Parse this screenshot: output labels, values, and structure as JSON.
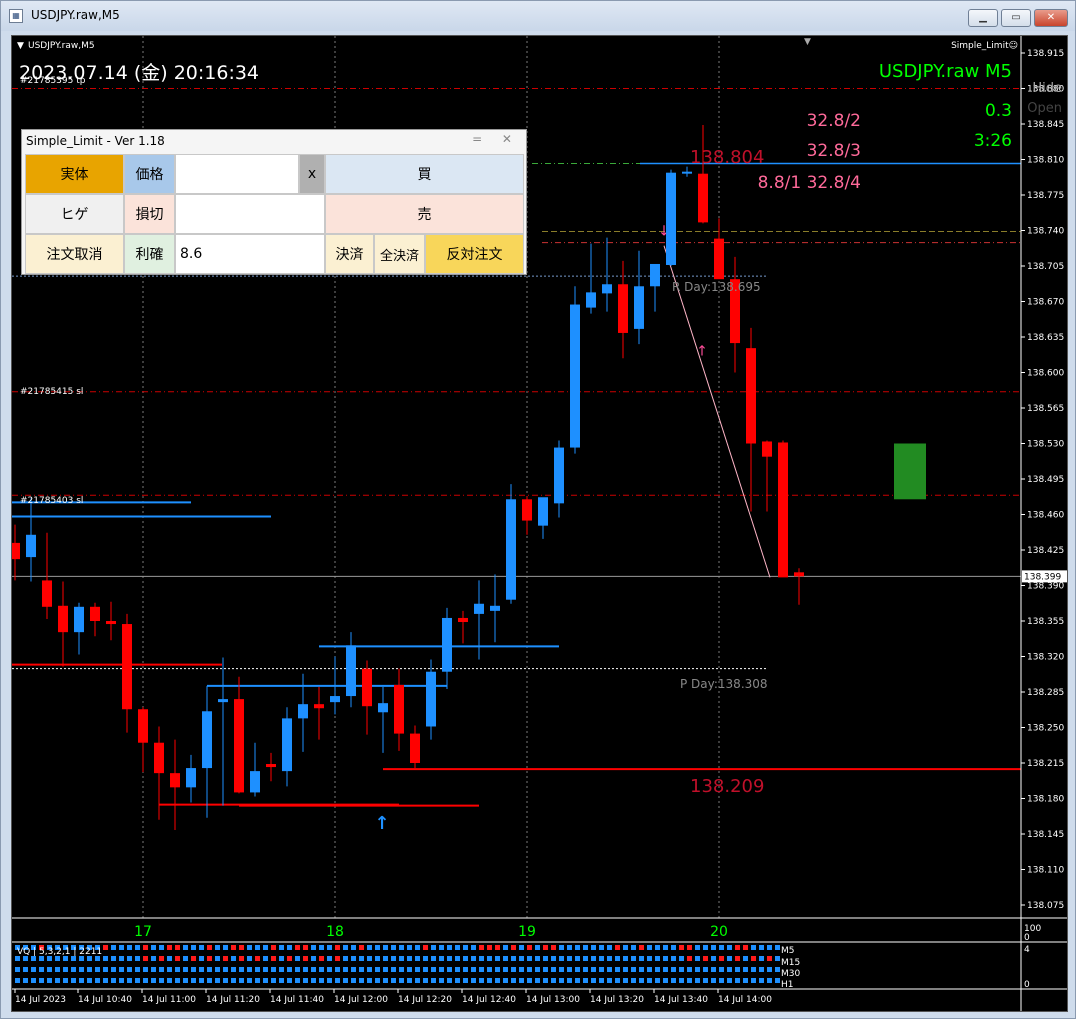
{
  "window": {
    "title": "USDJPY.raw,M5",
    "min_glyph": "▁",
    "max_glyph": "▭",
    "close_glyph": "✕"
  },
  "chart": {
    "corner_label": "USDJPY.raw,M5",
    "indicator_label": "Simple_Limit☺",
    "datetime": "2023.07.14 (金) 20:16:34",
    "symbol_tf": "USDJPY.raw  M5",
    "hide_label": "Hide",
    "open_label": "Open",
    "spread": "0.3",
    "countdown": "3:26",
    "stats": [
      "32.8/2",
      "32.8/3",
      "8.8/1  32.8/4"
    ],
    "high_price_label": "138.804",
    "low_price_label": "138.209",
    "r_day_label": "R Day:138.695",
    "p_day_label": "P Day:138.308",
    "order_labels": [
      "#21785395 tp",
      "#21785415 sl",
      "#21785403 sl"
    ],
    "price_ticks": [
      "138.915",
      "138.880",
      "138.845",
      "138.810",
      "138.775",
      "138.740",
      "138.705",
      "138.670",
      "138.635",
      "138.600",
      "138.565",
      "138.530",
      "138.495",
      "138.460",
      "138.425",
      "138.390",
      "138.355",
      "138.320",
      "138.285",
      "138.250",
      "138.215",
      "138.180",
      "138.145",
      "138.110",
      "138.075"
    ],
    "current_price": "138.399",
    "day_labels": [
      "17",
      "18",
      "19",
      "20"
    ],
    "sub_scale_top": "100",
    "sub_scale_bottom": "0",
    "sub2_scale_top": "4",
    "sub2_scale_bottom": "0",
    "vq_label": "VQ | 5,3,2,1 | 2211",
    "tf_labels": [
      "M5",
      "M15",
      "M30",
      "H1"
    ],
    "time_labels": [
      "14 Jul 2023",
      "14 Jul 10:40",
      "14 Jul 11:00",
      "14 Jul 11:20",
      "14 Jul 11:40",
      "14 Jul 12:00",
      "14 Jul 12:20",
      "14 Jul 12:40",
      "14 Jul 13:00",
      "14 Jul 13:20",
      "14 Jul 13:40",
      "14 Jul 14:00"
    ],
    "colors": {
      "bull": "#1e90ff",
      "bear": "#ff0000",
      "green_text": "#00ff00",
      "pink_text": "#ff6a9a",
      "grid": "#8a8a8a"
    }
  },
  "panel": {
    "title": "Simple_Limit - Ver 1.18",
    "controls": "= ✕",
    "btn_body": "実体",
    "btn_price": "価格",
    "price_value": "",
    "btn_x": "x",
    "btn_buy": "買",
    "btn_wick": "ヒゲ",
    "btn_sl": "損切",
    "sl_value": "",
    "btn_sell": "売",
    "btn_cancel": "注文取消",
    "btn_tp": "利確",
    "tp_value": "8.6",
    "btn_close": "決済",
    "btn_close_all": "全決済",
    "btn_reverse": "反対注文"
  }
}
